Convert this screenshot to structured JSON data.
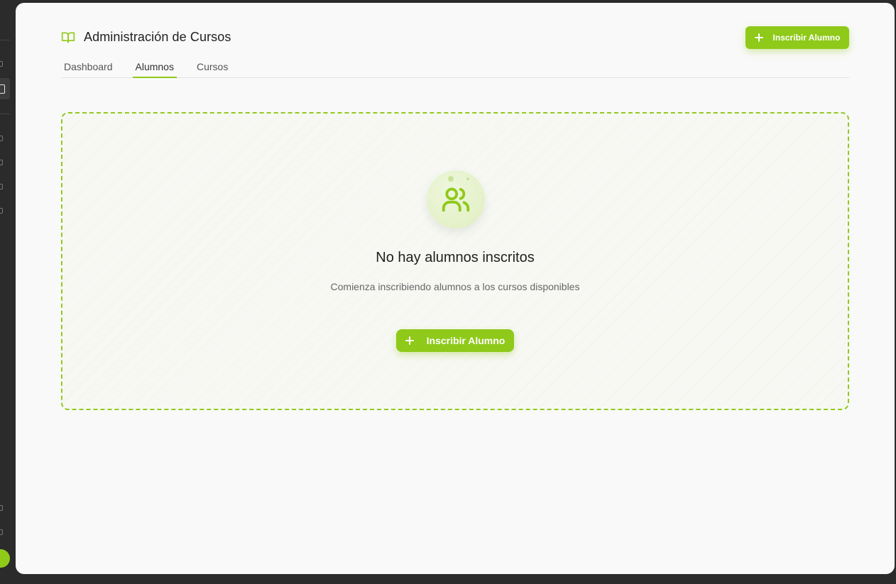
{
  "app": {
    "title": "Administración de Cursos",
    "accent_color": "#8fc919"
  },
  "header": {
    "icon": "book-open-icon",
    "enroll_button_label": "Inscribir Alumno"
  },
  "tabs": [
    {
      "label": "Dashboard",
      "active": false
    },
    {
      "label": "Alumnos",
      "active": true
    },
    {
      "label": "Cursos",
      "active": false
    }
  ],
  "empty_state": {
    "icon": "users-icon",
    "title": "No hay alumnos inscritos",
    "subtitle": "Comienza inscribiendo alumnos a los cursos disponibles",
    "button_label": "Inscribir Alumno"
  }
}
